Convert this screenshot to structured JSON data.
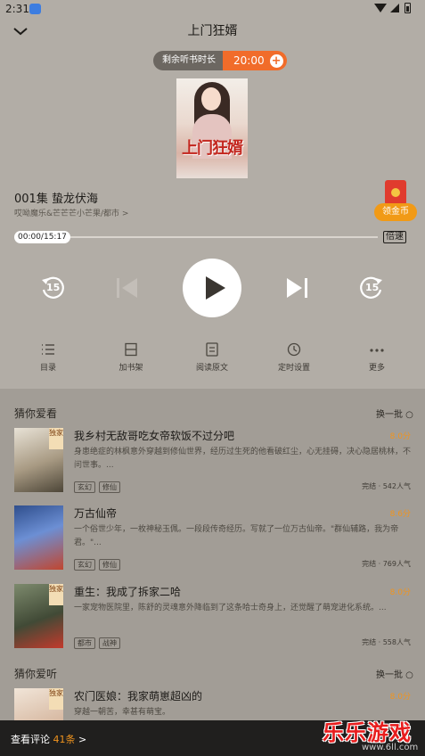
{
  "status_bar": {
    "time": "2:31"
  },
  "header": {
    "title": "上门狂婿"
  },
  "sleep_timer": {
    "label": "剩余听书时长",
    "value": "20:00"
  },
  "cover": {
    "title_text": "上门狂婿"
  },
  "episode": {
    "title": "001集 蛰龙伏海",
    "meta": "哎呦魔乐&芒芒芒小芒果/都市 >"
  },
  "coin_reward": {
    "label": "领金币"
  },
  "progress": {
    "time": "00:00/15:17",
    "played_fraction": 0.0,
    "speed_label": "倍速"
  },
  "controls": {
    "rewind_seconds": "15",
    "forward_seconds": "15"
  },
  "toolbar": {
    "items": [
      {
        "label": "目录",
        "icon": "list-icon"
      },
      {
        "label": "加书架",
        "icon": "bookshelf-add-icon"
      },
      {
        "label": "阅读原文",
        "icon": "document-icon"
      },
      {
        "label": "定时设置",
        "icon": "clock-icon"
      },
      {
        "label": "更多",
        "icon": "more-icon"
      }
    ]
  },
  "guess_watch": {
    "heading": "猜你爱看",
    "refresh_label": "换一批",
    "books": [
      {
        "title": "我乡村无敌哥吃女帝软饭不过分吧",
        "score": "8.0分",
        "badge": "独家",
        "description": "身患绝症的林枫意外穿越到修仙世界，经历过生死的他看破红尘，心无挂碍，决心隐居桃林，不问世事。...",
        "tags": [
          "玄幻",
          "修仙"
        ],
        "status": "完结 · 542人气"
      },
      {
        "title": "万古仙帝",
        "score": "8.6分",
        "badge": "",
        "description": "一个俗世少年，一枚神秘玉佩。一段段传奇经历。写就了一位万古仙帝。\"群仙辅路，我为帝君。\"...",
        "tags": [
          "玄幻",
          "修仙"
        ],
        "status": "完结 · 769人气"
      },
      {
        "title": "重生：我成了拆家二哈",
        "score": "8.0分",
        "badge": "独家",
        "description": "一家宠物医院里，陈舒的灵魂意外降临到了这条哈士奇身上，还觉醒了萌宠进化系统。...",
        "tags": [
          "都市",
          "战神"
        ],
        "status": "完结 · 558人气"
      }
    ]
  },
  "guess_listen": {
    "heading": "猜你爱听",
    "refresh_label": "换一批",
    "books": [
      {
        "title": "农门医娘：我家萌崽超凶的",
        "score": "8.0分",
        "badge": "独家",
        "description": "穿越一朝苦，幸甚有萌宝。"
      }
    ]
  },
  "bottom_bar": {
    "review_label": "查看评论",
    "review_count": "41条",
    "chevron": ">"
  },
  "watermark": {
    "text": "乐乐游戏",
    "url": "www.6ll.com"
  }
}
